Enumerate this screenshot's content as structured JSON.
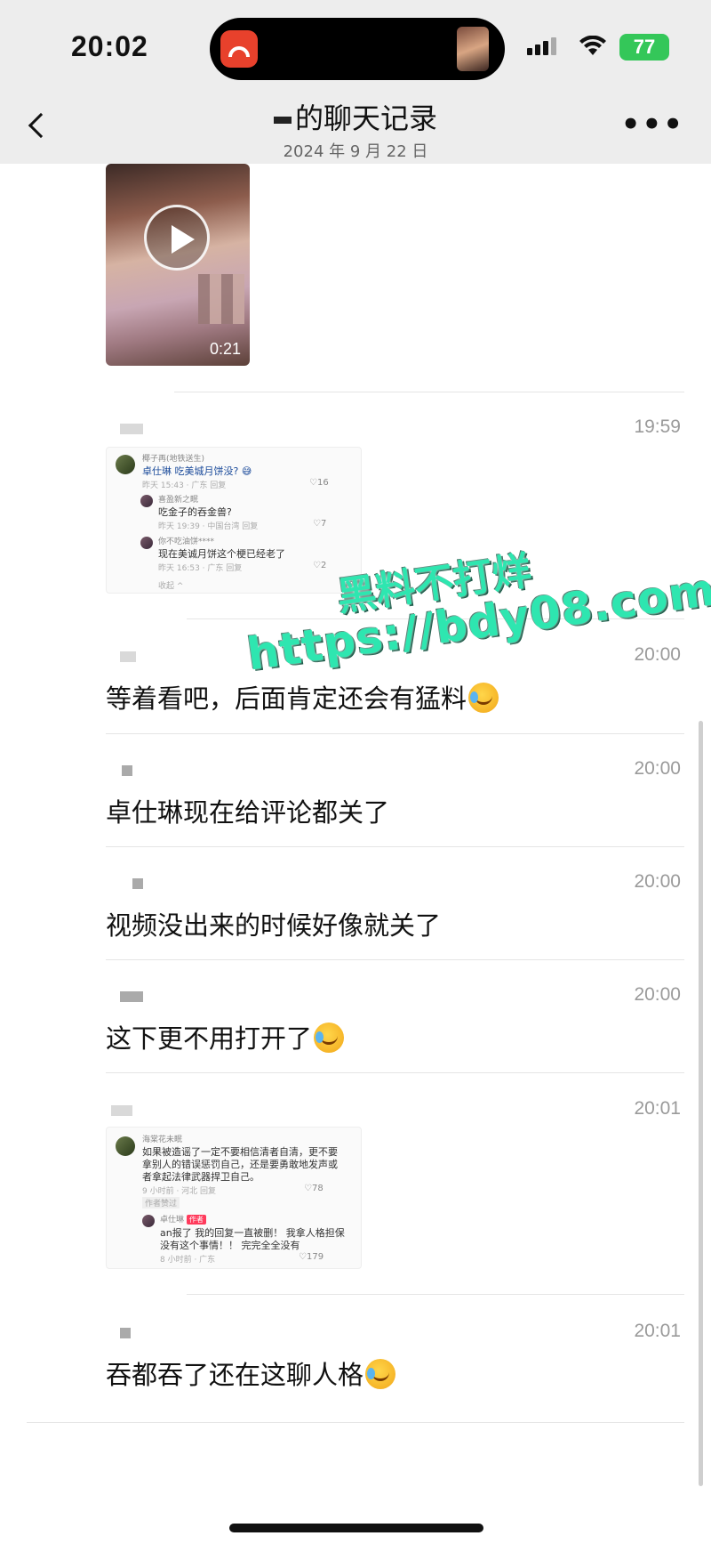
{
  "status_bar": {
    "time": "20:02",
    "battery": "77",
    "icons": [
      "app-icon",
      "thumbnail",
      "signal-icon",
      "wifi-icon",
      "battery-icon"
    ]
  },
  "header": {
    "title": "的聊天记录",
    "date": "2024 年 9 月 22 日",
    "more": "•••"
  },
  "video": {
    "duration": "0:21"
  },
  "messages": [
    {
      "time": "19:59",
      "type": "screenshot"
    },
    {
      "time": "20:00",
      "text": "等着看吧，后面肯定还会有猛料",
      "emoji": "crying-laughing"
    },
    {
      "time": "20:00",
      "text": "卓仕琳现在给评论都关了"
    },
    {
      "time": "20:00",
      "text": "视频没出来的时候好像就关了"
    },
    {
      "time": "20:00",
      "text": "这下更不用打开了",
      "emoji": "crying-laughing"
    },
    {
      "time": "20:01",
      "type": "screenshot"
    },
    {
      "time": "20:01",
      "text": "吞都吞了还在这聊人格",
      "emoji": "crying-laughing"
    }
  ],
  "screenshot1": {
    "name1": "椰子再(地铁送生)",
    "line1": "卓仕琳 吃美城月饼没? 😅",
    "meta1": "昨天 15:43 · 广东   回复",
    "like1": "♡16",
    "name2": "喜盈新之眠",
    "line2": "吃金子的吞金兽?",
    "meta2": "昨天 19:39 · 中国台湾   回复",
    "like2": "♡7",
    "name3": "你不吃油饼****",
    "line3": "现在美诚月饼这个梗已经老了",
    "meta3": "昨天 16:53 · 广东   回复",
    "like3": "♡2",
    "collapse": "收起 ^"
  },
  "screenshot2": {
    "name1": "海棠花未眠",
    "line1a": "如果被造谣了一定不要相信清者自清，更不要",
    "line1b": "拿别人的错误惩罚自己，还是要勇敢地发声或",
    "line1c": "者拿起法律武器捍卫自己。",
    "meta1": "9 小时前 · 河北   回复",
    "like1": "♡78",
    "liked_by": "作者赞过",
    "name2": "卓仕琳",
    "author_tag": "作者",
    "line2a": "an报了 我的回复一直被删！ 我拿人格担保",
    "line2b": "没有这个事情！！ 完完全全没有",
    "meta2": "8 小时前 · 广东",
    "like2": "♡179"
  },
  "watermark": {
    "line1": "黑料不打烊",
    "line2": "https://bdy08.com"
  }
}
